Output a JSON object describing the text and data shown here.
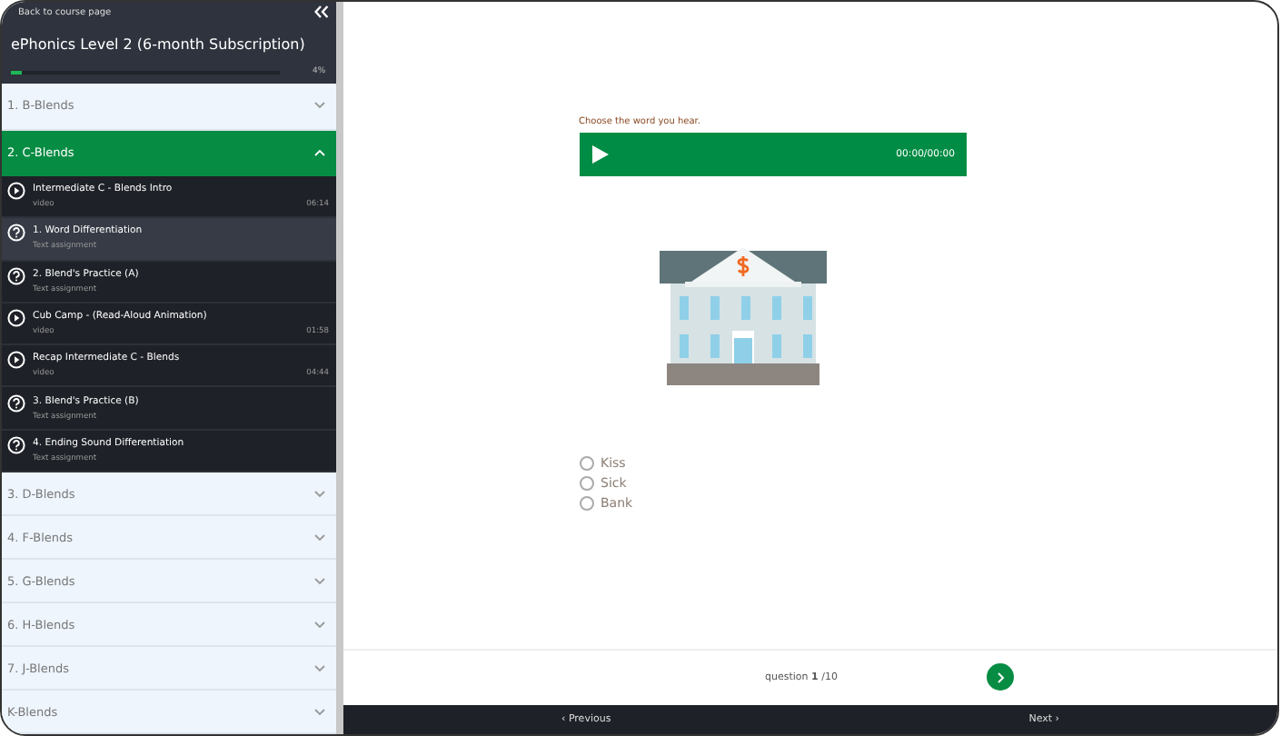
{
  "sidebar": {
    "back_link": "Back to course page",
    "course_title": "ePhonics Level 2 (6-month Subscription)",
    "progress": {
      "level": 0.04,
      "reading": "4%"
    },
    "sections": [
      {
        "title": "1. B-Blends",
        "expanded": false
      },
      {
        "title": "2. C-Blends",
        "expanded": true,
        "items": [
          {
            "kind": "video",
            "title": "Intermediate C - Blends Intro",
            "subtitle": "video",
            "duration": "06:14",
            "selected": false
          },
          {
            "kind": "question",
            "title": "1. Word Differentiation",
            "subtitle": "Text assignment",
            "selected": true
          },
          {
            "kind": "question",
            "title": "2. Blend's Practice (A)",
            "subtitle": "Text assignment",
            "selected": false
          },
          {
            "kind": "video",
            "title": "Cub Camp - (Read-Aloud Animation)",
            "subtitle": "video",
            "duration": "01:58",
            "selected": false
          },
          {
            "kind": "video",
            "title": "Recap Intermediate C - Blends",
            "subtitle": "video",
            "duration": "04:44",
            "selected": false
          },
          {
            "kind": "question",
            "title": "3. Blend's Practice (B)",
            "subtitle": "Text assignment",
            "selected": false
          },
          {
            "kind": "question",
            "title": "4. Ending Sound Differentiation",
            "subtitle": "Text assignment",
            "selected": false
          }
        ]
      },
      {
        "title": "3. D-Blends",
        "expanded": false
      },
      {
        "title": "4. F-Blends",
        "expanded": false
      },
      {
        "title": "5. G-Blends",
        "expanded": false
      },
      {
        "title": "6. H-Blends",
        "expanded": false
      },
      {
        "title": "7. J-Blends",
        "expanded": false
      },
      {
        "title": "K-Blends",
        "expanded": false
      }
    ]
  },
  "question": {
    "prompt": "Choose the word you hear.",
    "audio_time": "00:00/00:00",
    "options": [
      {
        "label": "Kiss",
        "selected": false
      },
      {
        "label": "Sick",
        "selected": false
      },
      {
        "label": "Bank",
        "selected": false
      }
    ],
    "counter": "question **1** /10"
  },
  "nav": {
    "previous": "‹ Previous",
    "next": "Next ›"
  }
}
